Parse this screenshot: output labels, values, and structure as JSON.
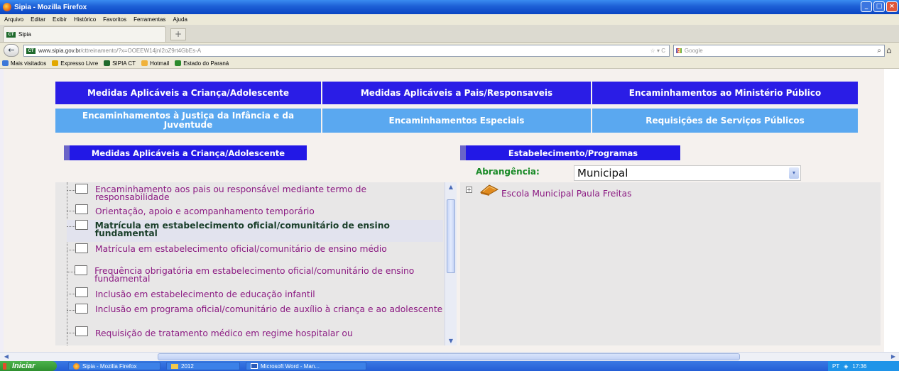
{
  "window": {
    "title": "Sipia - Mozilla Firefox",
    "buttons": [
      "_",
      "□",
      "×"
    ]
  },
  "menu": [
    "Arquivo",
    "Editar",
    "Exibir",
    "Histórico",
    "Favoritos",
    "Ferramentas",
    "Ajuda"
  ],
  "tab": {
    "label": "Sipia",
    "favicon": "CT",
    "new_tab": "+"
  },
  "nav": {
    "url_host": "www.sipia.gov.br",
    "url_path": "/cttreinamento/?x=OOEEW14jnI2oZ9rt4GbEs-A",
    "url_controls": "☆ ▾ C",
    "search_placeholder": "Google"
  },
  "bookmarks": [
    {
      "label": "Mais visitados",
      "color": "#3d78d8"
    },
    {
      "label": "Expresso Livre",
      "color": "#e2a800"
    },
    {
      "label": "SIPIA CT",
      "color": "#1f6a2c"
    },
    {
      "label": "Hotmail",
      "color": "#f0b23a"
    },
    {
      "label": "Estado do Paraná",
      "color": "#2b8a2b"
    }
  ],
  "topnav": [
    "Medidas Aplicáveis a Criança/Adolescente",
    "Medidas Aplicáveis a Pais/Responsaveis",
    "Encaminhamentos ao Ministério Público",
    "Encaminhamentos à Justiça da Infância e da Juventude",
    "Encaminhamentos Especiais",
    "Requisições de Serviços Públicos"
  ],
  "left_header": "Medidas Aplicáveis a Criança/Adolescente",
  "right_header": "Estabelecimento/Programas",
  "abrangencia": {
    "label": "Abrangência:",
    "value": "Municipal"
  },
  "measures": [
    "Encaminhamento aos pais ou responsável mediante termo de responsabilidade",
    "Orientação, apoio e acompanhamento temporário",
    "Matrícula em estabelecimento oficial/comunitário de ensino fundamental",
    "Matrícula em estabelecimento oficial/comunitário de ensino médio",
    "Frequência obrigatória em estabelecimento oficial/comunitário de ensino fundamental",
    "Inclusão em estabelecimento de educação infantil",
    "Inclusão em programa oficial/comunitário de auxílio à criança e ao adolescente",
    "Requisição de tratamento médico em regime hospitalar ou"
  ],
  "selected_measure_index": 2,
  "establishment": {
    "label": "Escola Municipal Paula Freitas"
  },
  "taskbar": {
    "start": "Iniciar",
    "tasks": [
      "Sipia - Mozilla Firefox",
      "2012",
      "Microsoft Word - Man..."
    ],
    "lang": "PT",
    "time": "17:36"
  }
}
